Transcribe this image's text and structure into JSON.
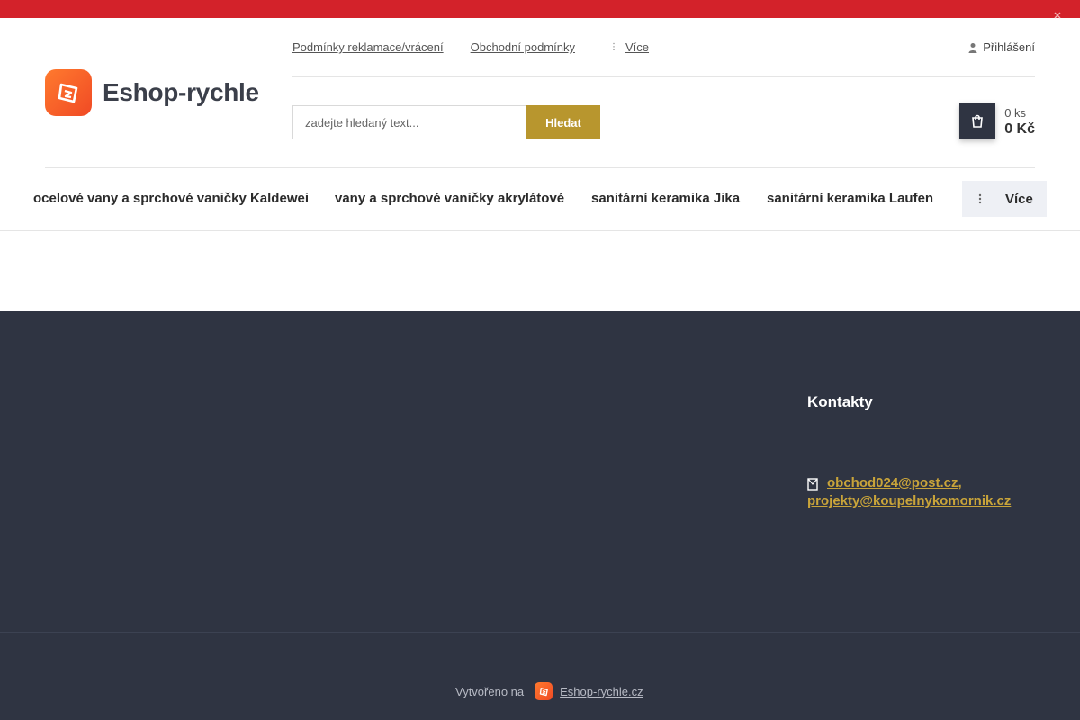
{
  "topbar": {
    "accent_color": "#d3222a",
    "close_icon": "close-icon"
  },
  "header": {
    "logo_text": "Eshop-rychle",
    "links": [
      {
        "label": "Podmínky reklamace/vrácení"
      },
      {
        "label": "Obchodní podmínky"
      }
    ],
    "more_label": "Více",
    "login_label": "Přihlášení",
    "search": {
      "placeholder": "zadejte hledaný text...",
      "button_label": "Hledat"
    },
    "cart": {
      "qty": "0 ks",
      "price": "0 Kč",
      "icon": "cart-icon"
    }
  },
  "nav": {
    "items": [
      {
        "label": "ocelové vany a sprchové vaničky Kaldewei"
      },
      {
        "label": "vany a sprchové vaničky akrylátové"
      },
      {
        "label": "sanitární keramika Jika"
      },
      {
        "label": "sanitární keramika Laufen"
      }
    ],
    "more_label": "Více"
  },
  "footer": {
    "contacts_title": "Kontakty",
    "email_1": "obchod024@post.cz,",
    "email_2": "projekty@koupelnykomornik.cz",
    "credit_text": "Vytvořeno na",
    "credit_link": "Eshop-rychle.cz",
    "bg_color": "#2f3442",
    "link_color": "#c9a43a"
  }
}
